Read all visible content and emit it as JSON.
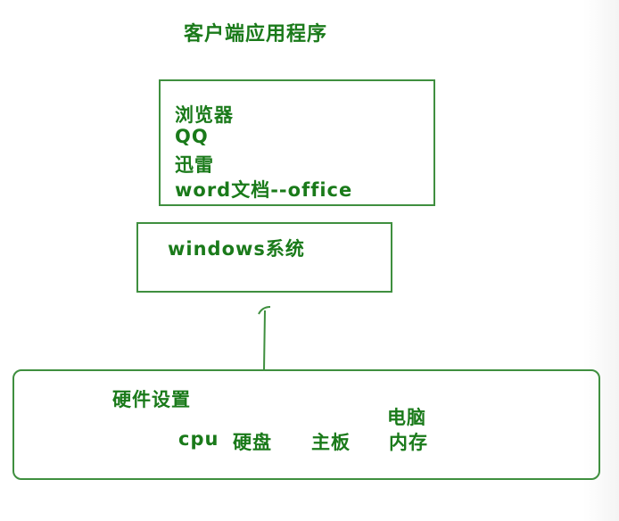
{
  "title": "客户端应用程序",
  "apps_box": {
    "items": [
      "浏览器",
      "QQ",
      "迅雷",
      "word文档--office"
    ]
  },
  "os_box": {
    "label": "windows系统"
  },
  "hardware_box": {
    "label": "硬件设置",
    "computer_label": "电脑",
    "items": [
      "cpu",
      "硬盘",
      "主板",
      "内存"
    ]
  },
  "colors": {
    "text": "#1a7a1a",
    "border": "#3f8f3f"
  }
}
